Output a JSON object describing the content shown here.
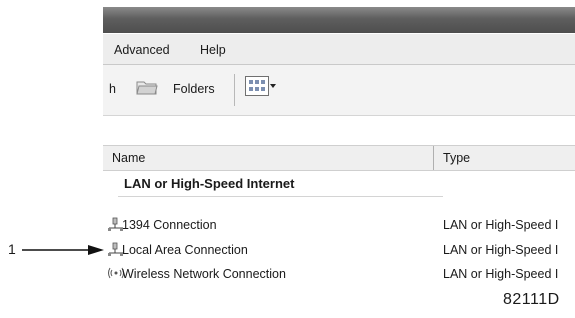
{
  "menu": {
    "items": [
      {
        "label": "Advanced"
      },
      {
        "label": "Help"
      }
    ]
  },
  "toolbar": {
    "partial_label": "h",
    "folders_label": "Folders",
    "views_icon": "views-icon"
  },
  "list": {
    "columns": [
      "Name",
      "Type"
    ],
    "group_heading": "LAN or High-Speed Internet",
    "rows": [
      {
        "name": "1394 Connection",
        "type": "LAN or High-Speed I",
        "icon": "network-connection-icon"
      },
      {
        "name": "Local Area Connection",
        "type": "LAN or High-Speed I",
        "icon": "network-connection-icon"
      },
      {
        "name": "Wireless Network Connection",
        "type": "LAN or High-Speed I",
        "icon": "wireless-connection-icon"
      }
    ]
  },
  "callout": {
    "number": "1"
  },
  "figure_id": "82111D",
  "colors": {
    "titlebar": "#5e5e5e",
    "menubar": "#ededed",
    "header": "#efefef"
  }
}
